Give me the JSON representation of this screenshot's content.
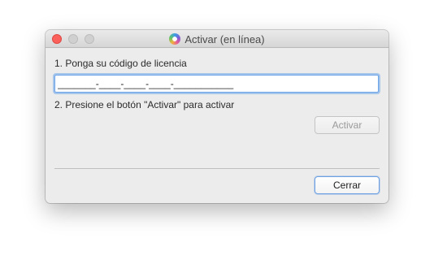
{
  "window": {
    "title": "Activar (en línea)",
    "app_icon": "app-logo-icon"
  },
  "steps": {
    "step1_label": "1. Ponga su código de licencia",
    "step2_label": "2. Presione el botón \"Activar\" para activar"
  },
  "license": {
    "value": "_______-____-____-____-___________",
    "placeholder": ""
  },
  "buttons": {
    "activate": "Activar",
    "close": "Cerrar"
  },
  "colors": {
    "close_button": "#fc605b",
    "focus_ring": "#6da3e8"
  }
}
